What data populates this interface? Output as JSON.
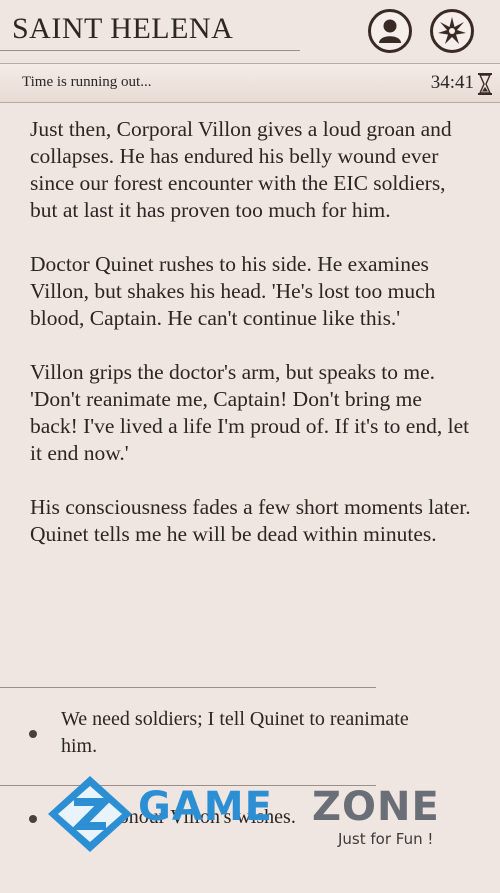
{
  "header": {
    "title": "SAINT HELENA",
    "profile_icon": "person-icon",
    "settings_icon": "compass-star-icon"
  },
  "status": {
    "message": "Time is running out...",
    "timer": "34:41",
    "timer_icon": "hourglass-icon"
  },
  "story": {
    "paragraphs": [
      "Just then, Corporal Villon gives a loud groan and collapses. He has endured his belly wound ever since our forest encounter with the EIC soldiers, but at last it has proven too much for him.",
      "Doctor Quinet rushes to his side. He examines Villon, but shakes his head. 'He's lost too much blood, Captain. He can't continue like this.'",
      "Villon grips the doctor's arm, but speaks to me. 'Don't reanimate me, Captain! Don't bring me back! I've lived a life I'm proud of. If it's to end, let it end now.'",
      "His consciousness fades a few short moments later. Quinet tells me he will be dead within minutes."
    ]
  },
  "choices": [
    {
      "text": "We need soldiers; I tell Quinet to reanimate him."
    },
    {
      "text": "I will honour Villon's wishes."
    }
  ],
  "watermark": {
    "brand_game": "GAME",
    "brand_zone": "ZONE",
    "tagline": "Just for Fun !"
  },
  "colors": {
    "background": "#efe5e1",
    "text": "#2b2623",
    "icon_dark": "#3a2a25",
    "watermark_blue": "#2c8fd4"
  }
}
